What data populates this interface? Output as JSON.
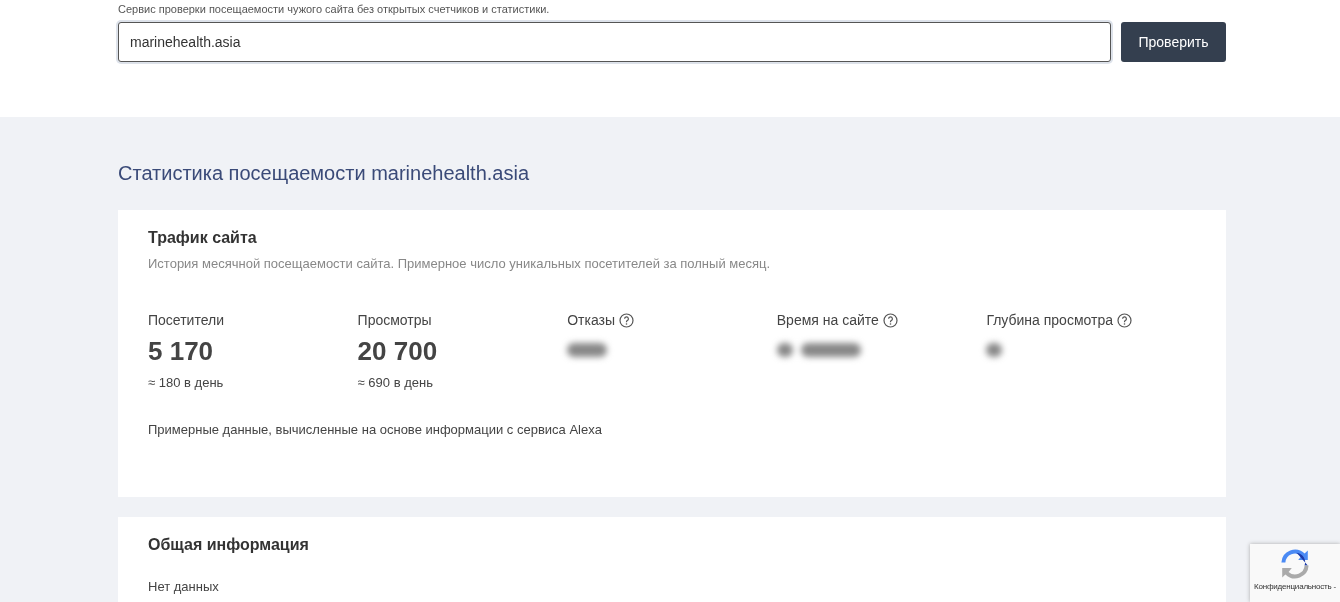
{
  "intro": "Сервис проверки посещаемости чужого сайта без открытых счетчиков и статистики.",
  "search": {
    "value": "marinehealth.asia",
    "button": "Проверить"
  },
  "heading": "Статистика посещаемости marinehealth.asia",
  "traffic": {
    "title": "Трафик сайта",
    "subtitle": "История месячной посещаемости сайта. Примерное число уникальных посетителей за полный месяц.",
    "stats": [
      {
        "kind": "value",
        "label": "Посетители",
        "value": "5 170",
        "per_day": "≈ 180 в день",
        "help": false
      },
      {
        "kind": "value",
        "label": "Просмотры",
        "value": "20 700",
        "per_day": "≈ 690 в день",
        "help": false
      },
      {
        "kind": "hidden",
        "label": "Отказы",
        "help": true
      },
      {
        "kind": "hidden",
        "label": "Время на сайте",
        "help": true
      },
      {
        "kind": "hidden",
        "label": "Глубина просмотра",
        "help": true
      }
    ],
    "note": "Примерные данные, вычисленные на основе информации с сервиса Alexa"
  },
  "general": {
    "title": "Общая информация",
    "text": "Нет данных"
  },
  "captcha": {
    "text": "Конфиденциальность -"
  }
}
